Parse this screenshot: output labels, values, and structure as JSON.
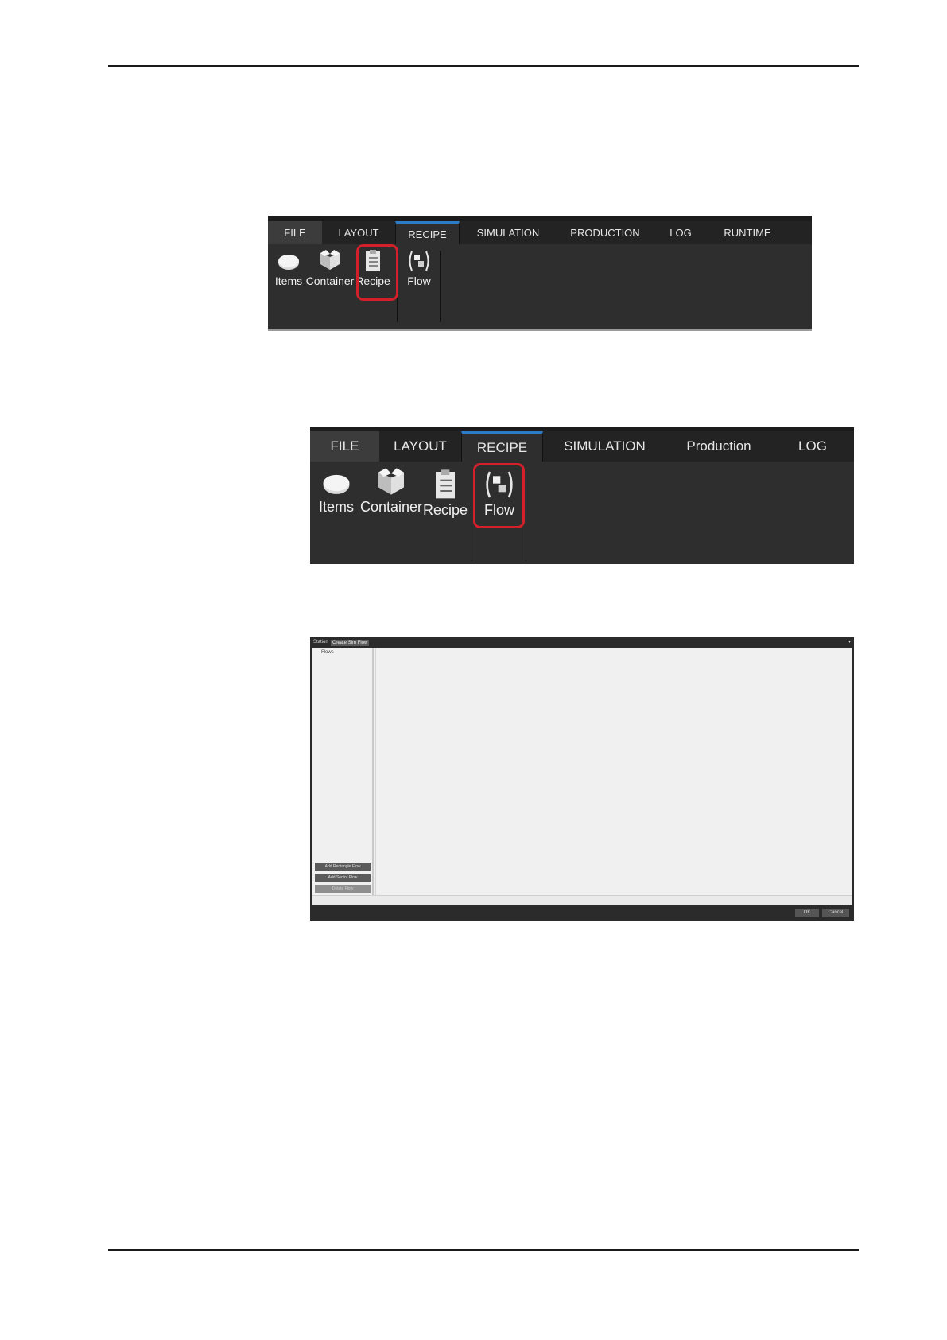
{
  "ribbon1": {
    "tabs": [
      "FILE",
      "LAYOUT",
      "RECIPE",
      "SIMULATION",
      "PRODUCTION",
      "LOG",
      "RUNTIME"
    ],
    "tools": {
      "items": "Items",
      "container": "Container",
      "recipe": "Recipe",
      "flow": "Flow"
    },
    "active_tab": "RECIPE",
    "highlighted": "Recipe"
  },
  "ribbon2": {
    "tabs": [
      "FILE",
      "LAYOUT",
      "RECIPE",
      "SIMULATION",
      "Production",
      "LOG"
    ],
    "tools": {
      "items": "Items",
      "container": "Container",
      "recipe": "Recipe",
      "flow": "Flow"
    },
    "active_tab": "RECIPE",
    "highlighted": "Flow"
  },
  "dialog": {
    "title_label": "Station",
    "title_tab": "Create Sim Flow",
    "tree_root": "Flows",
    "buttons": {
      "add_rectangle": "Add Rectangle Flow",
      "add_sector": "Add Sector Flow",
      "delete": "Delete Flow"
    },
    "ok": "OK",
    "cancel": "Cancel"
  },
  "colors": {
    "highlight": "#d4202a",
    "active_tab_accent": "#2b7bc8",
    "ribbon_bg": "#2e2e2e"
  }
}
